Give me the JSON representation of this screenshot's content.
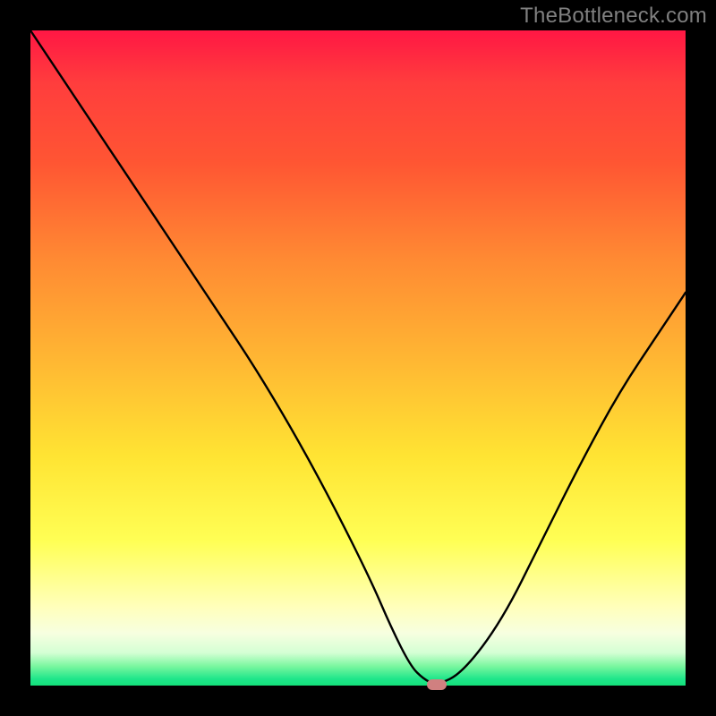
{
  "watermark": "TheBottleneck.com",
  "chart_data": {
    "type": "line",
    "title": "",
    "xlabel": "",
    "ylabel": "",
    "xlim": [
      0,
      100
    ],
    "ylim": [
      0,
      100
    ],
    "series": [
      {
        "name": "bottleneck-curve",
        "x": [
          0,
          8,
          16,
          22,
          28,
          34,
          40,
          46,
          52,
          55,
          58,
          60,
          62,
          66,
          72,
          78,
          84,
          90,
          96,
          100
        ],
        "values": [
          100,
          88,
          76,
          67,
          58,
          49,
          39,
          28,
          16,
          9,
          3,
          1,
          0,
          2,
          10,
          22,
          34,
          45,
          54,
          60
        ]
      }
    ],
    "marker": {
      "x": 62,
      "y": 0
    },
    "background_gradient": {
      "top": "#ff1744",
      "mid": "#ffe433",
      "bottom": "#14e07a"
    }
  }
}
